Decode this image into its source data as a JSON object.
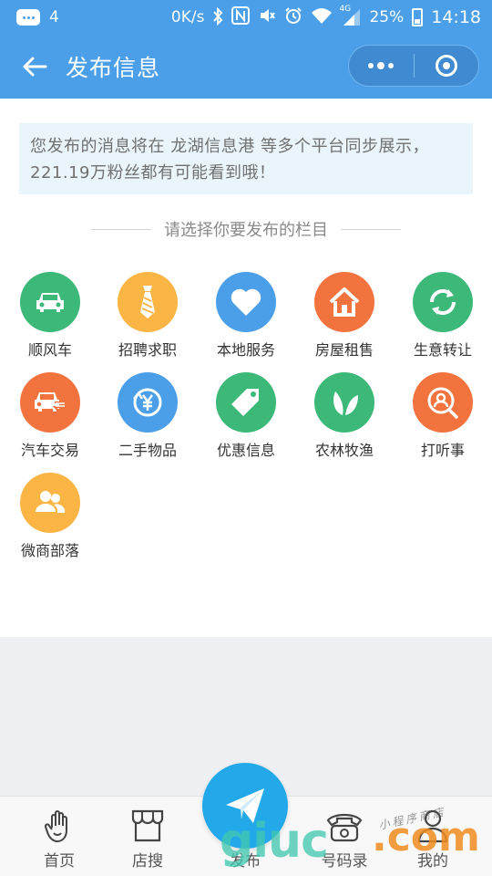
{
  "status_bar": {
    "notification_count": "4",
    "network_speed": "0K/s",
    "network_type": "4G",
    "battery": "25%",
    "time": "14:18"
  },
  "nav": {
    "title": "发布信息",
    "capsule_left_icon": "more-dots-icon",
    "capsule_right_icon": "close-target-icon",
    "background": "#4a9fe8"
  },
  "notice": {
    "text": "您发布的消息将在 龙湖信息港 等多个平台同步展示，221.19万粉丝都有可能看到哦！"
  },
  "section": {
    "heading": "请选择你要发布的栏目"
  },
  "categories": [
    {
      "label": "顺风车",
      "icon": "car-icon",
      "color": "#3cb878"
    },
    {
      "label": "招聘求职",
      "icon": "tie-icon",
      "color": "#fbb545"
    },
    {
      "label": "本地服务",
      "icon": "heart-icon",
      "color": "#4b9ee8"
    },
    {
      "label": "房屋租售",
      "icon": "house-icon",
      "color": "#f2733e"
    },
    {
      "label": "生意转让",
      "icon": "transfer-icon",
      "color": "#3cb878"
    },
    {
      "label": "汽车交易",
      "icon": "car-exchange-icon",
      "color": "#f2733e"
    },
    {
      "label": "二手物品",
      "icon": "yen-icon",
      "color": "#4b9ee8"
    },
    {
      "label": "优惠信息",
      "icon": "tag-icon",
      "color": "#3cb878"
    },
    {
      "label": "农林牧渔",
      "icon": "leaf-icon",
      "color": "#3cb878"
    },
    {
      "label": "打听事",
      "icon": "search-person-icon",
      "color": "#f2733e"
    },
    {
      "label": "微商部落",
      "icon": "group-icon",
      "color": "#fbb545"
    }
  ],
  "tabs": [
    {
      "label": "首页",
      "icon": "hand-icon"
    },
    {
      "label": "店搜",
      "icon": "shop-icon"
    },
    {
      "label": "发布",
      "icon": "paper-plane-icon"
    },
    {
      "label": "号码录",
      "icon": "phone-icon"
    },
    {
      "label": "我的",
      "icon": "user-icon"
    }
  ],
  "watermark": {
    "text": "giuc",
    "dot_com": ".com",
    "small": "小程序商店"
  }
}
